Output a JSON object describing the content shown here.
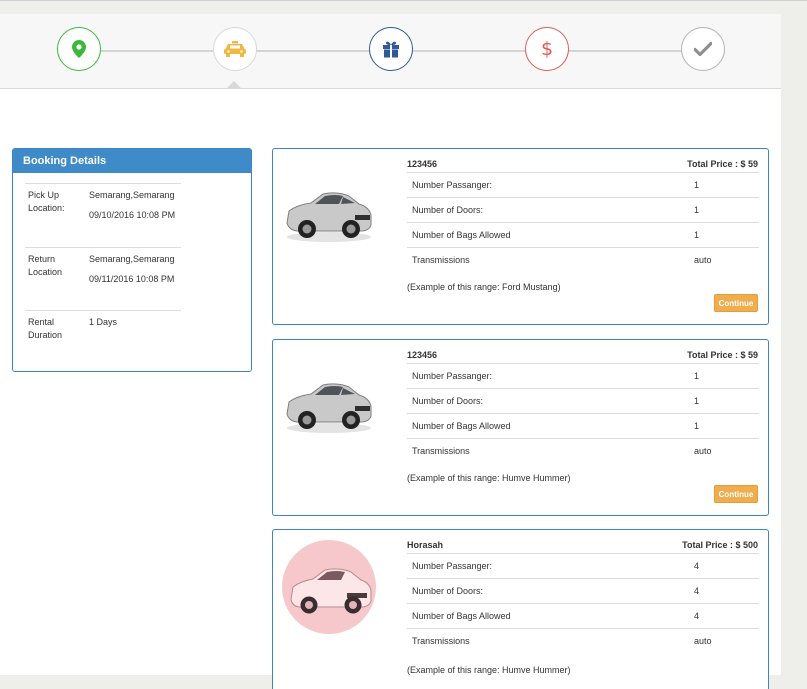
{
  "steps": [
    {
      "icon": "map-marker-icon",
      "color": "#3bb83b"
    },
    {
      "icon": "taxi-icon",
      "color": "#f0b841",
      "active": true
    },
    {
      "icon": "gift-icon",
      "color": "#2e5a95"
    },
    {
      "icon": "dollar-icon",
      "color": "#e05b55"
    },
    {
      "icon": "check-icon",
      "color": "#8f8f8f"
    }
  ],
  "booking": {
    "title": "Booking Details",
    "pickup": {
      "label": "Pick Up Location:",
      "place": "Semarang,Semarang",
      "datetime": "09/10/2016 10:08 PM"
    },
    "return": {
      "label": "Return Location",
      "place": "Semarang,Semarang",
      "datetime": "09/11/2016 10:08 PM"
    },
    "duration": {
      "label": "Rental Duration",
      "value": "1 Days"
    }
  },
  "cars": [
    {
      "name": "123456",
      "price": "Total Price : $ 59",
      "specs": [
        {
          "label": "Number Passanger:",
          "value": "1"
        },
        {
          "label": "Number of Doors:",
          "value": "1"
        },
        {
          "label": "Number of Bags Allowed",
          "value": "1"
        },
        {
          "label": "Transmissions",
          "value": "auto"
        }
      ],
      "example": "(Example of this range: Ford Mustang)",
      "button": "Continue"
    },
    {
      "name": "123456",
      "price": "Total Price : $ 59",
      "specs": [
        {
          "label": "Number Passanger:",
          "value": "1"
        },
        {
          "label": "Number of Doors:",
          "value": "1"
        },
        {
          "label": "Number of Bags Allowed",
          "value": "1"
        },
        {
          "label": "Transmissions",
          "value": "auto"
        }
      ],
      "example": "(Example of this range: Humve Hummer)",
      "button": "Continue"
    },
    {
      "name": "Horasah",
      "price": "Total Price : $ 500",
      "specs": [
        {
          "label": "Number Passanger:",
          "value": "4"
        },
        {
          "label": "Number of Doors:",
          "value": "4"
        },
        {
          "label": "Number of Bags Allowed",
          "value": "4"
        },
        {
          "label": "Transmissions",
          "value": "auto"
        }
      ],
      "example": "(Example of this range: Humve Hummer)"
    }
  ]
}
